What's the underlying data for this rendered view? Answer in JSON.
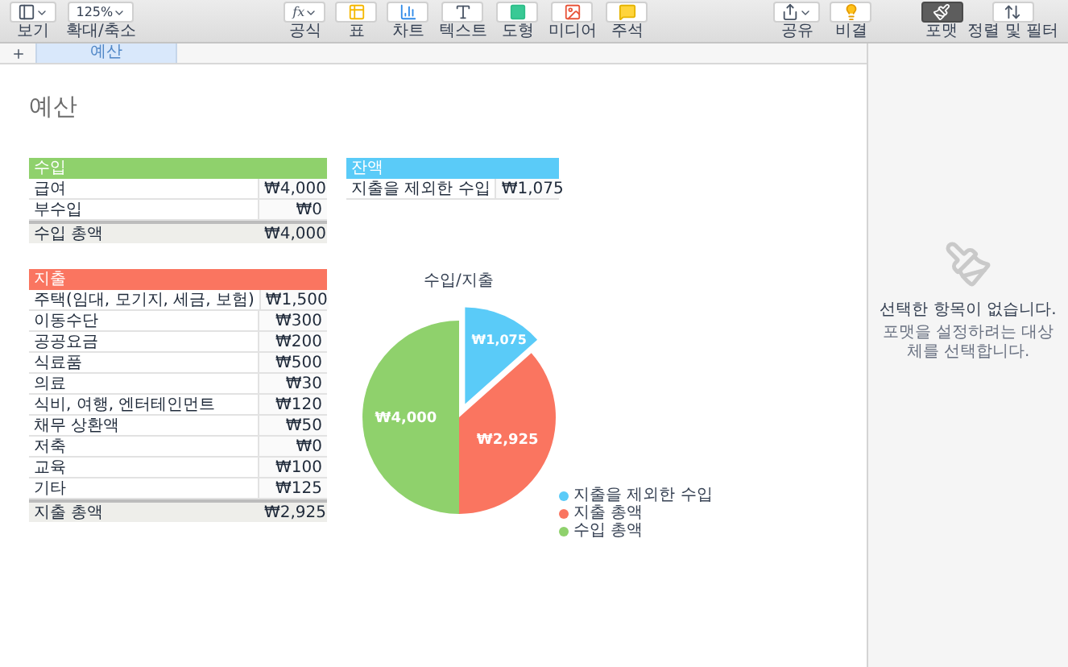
{
  "toolbar": {
    "left": [
      {
        "kind": "view",
        "label": "보기"
      },
      {
        "kind": "zoom",
        "value": "125%",
        "label": "확대/축소"
      }
    ],
    "insert": [
      {
        "kind": "formula",
        "value": "fx",
        "label": "공식"
      },
      {
        "kind": "table",
        "label": "표"
      },
      {
        "kind": "chart",
        "label": "차트"
      },
      {
        "kind": "text",
        "label": "텍스트"
      },
      {
        "kind": "shape",
        "label": "도형"
      },
      {
        "kind": "media",
        "label": "미디어"
      },
      {
        "kind": "comment",
        "label": "주석"
      }
    ],
    "share": [
      {
        "kind": "share",
        "label": "공유"
      },
      {
        "kind": "tips",
        "label": "비결"
      }
    ],
    "inspector": [
      {
        "kind": "format",
        "label": "포맷",
        "selected": true
      },
      {
        "kind": "sort",
        "label": "정렬 및 필터",
        "selected": false
      }
    ]
  },
  "sheet_tabs": [
    {
      "label": "예산",
      "selected": true
    }
  ],
  "sheet_title": "예산",
  "income_table": {
    "header": "수입",
    "color": "#8fd16c",
    "rows": [
      {
        "label": "급여",
        "value": "₩4,000"
      },
      {
        "label": "부수입",
        "value": "₩0"
      }
    ],
    "total": {
      "label": "수입 총액",
      "value": "₩4,000"
    }
  },
  "balance_table": {
    "header": "잔액",
    "color": "#5acbf8",
    "rows": [
      {
        "label": "지출을 제외한 수입",
        "value": "₩1,075"
      }
    ]
  },
  "expense_table": {
    "header": "지출",
    "color": "#fa7560",
    "rows": [
      {
        "label": "주택(임대, 모기지, 세금, 보험)",
        "value": "₩1,500"
      },
      {
        "label": "이동수단",
        "value": "₩300"
      },
      {
        "label": "공공요금",
        "value": "₩200"
      },
      {
        "label": "식료품",
        "value": "₩500"
      },
      {
        "label": "의료",
        "value": "₩30"
      },
      {
        "label": "식비, 여행, 엔터테인먼트",
        "value": "₩120"
      },
      {
        "label": "채무 상환액",
        "value": "₩50"
      },
      {
        "label": "저축",
        "value": "₩0"
      },
      {
        "label": "교육",
        "value": "₩100"
      },
      {
        "label": "기타",
        "value": "₩125"
      }
    ],
    "total": {
      "label": "지출 총액",
      "value": "₩2,925"
    }
  },
  "chart": {
    "chart_data": {
      "type": "pie",
      "title": "수입/지출",
      "categories": [
        "지출을 제외한 수입",
        "지출 총액",
        "수입 총액"
      ],
      "values": [
        1075,
        2925,
        4000
      ],
      "value_labels": [
        "₩1,075",
        "₩2,925",
        "₩4,000"
      ]
    },
    "legend": [
      {
        "color": "#5acbf8"
      },
      {
        "color": "#fa7560"
      },
      {
        "color": "#8fd16c"
      }
    ]
  },
  "sidebar": {
    "message": "선택한 항목이 없습니다.",
    "hint": "포맷을 설정하려는 대상체를 선택합니다."
  }
}
